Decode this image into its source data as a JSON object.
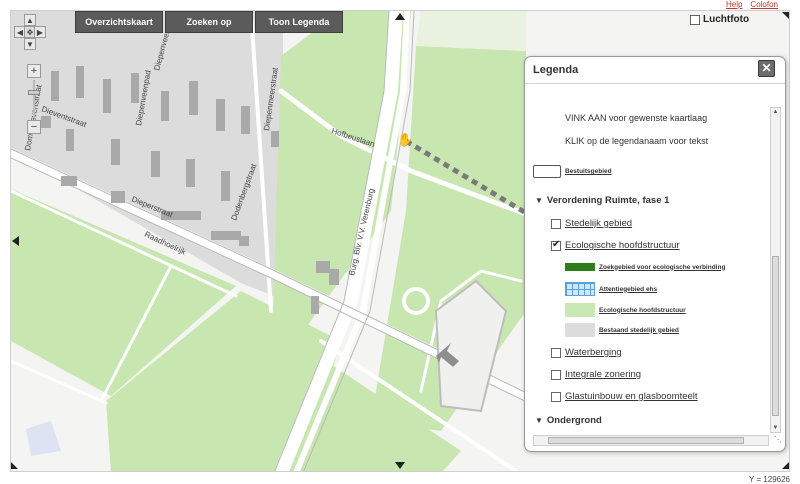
{
  "toolbar": {
    "overview_label": "Overzichtskaart",
    "search_label": "Zoeken op",
    "legend_label": "Toon Legenda"
  },
  "top_links": {
    "help_label": "Help",
    "colofon_label": "Colofon"
  },
  "aerial": {
    "label": "Luchtfoto",
    "checked": false
  },
  "map": {
    "streets": [
      {
        "name": "Dommelsvenstraat"
      },
      {
        "name": "Diepenveenpad"
      },
      {
        "name": "Dieventstraat"
      },
      {
        "name": "Diepenveenstraat"
      },
      {
        "name": "Dodenbergstraat"
      },
      {
        "name": "Dieperstraat"
      },
      {
        "name": "Diepenmeerstraat"
      },
      {
        "name": "Raadhoelrijk"
      },
      {
        "name": "Burg. Blv. V.V. Verenburg"
      },
      {
        "name": "Hofbeuslaan"
      }
    ],
    "colors": {
      "residential": "#dcdcdc",
      "green": "#c8e6b0",
      "road": "#ffffff",
      "building": "#a9a9a9",
      "background": "#f4f4f2"
    }
  },
  "legend": {
    "title": "Legenda",
    "close_icon": "close-icon",
    "instruction_1": "VINK AAN voor gewenste kaartlaag",
    "instruction_2": "KLIK op de legendanaam voor tekst",
    "base_label": "Bestuitsgebied",
    "group_1": {
      "label": "Verordening Ruimte, fase 1",
      "expanded": true,
      "layers": [
        {
          "label": "Stedelijk gebied",
          "checked": false
        },
        {
          "label": "Ecologische hoofdstructuur",
          "checked": true
        },
        {
          "label": "Waterberging",
          "checked": false
        },
        {
          "label": "Integrale zonering",
          "checked": false
        },
        {
          "label": "Glastuinbouw en glasboomteelt",
          "checked": false
        }
      ],
      "subitems": [
        {
          "label": "Zoekgebied voor ecologische verbinding",
          "color": "#2e7d1a"
        },
        {
          "label": "Attentiegebied ehs",
          "color": "#5aa0e0"
        },
        {
          "label": "Ecologische hoofdstructuur",
          "color": "#c8e8b4"
        },
        {
          "label": "Bestaand stedelijk gebied",
          "color": "#dcdcdc"
        }
      ]
    },
    "group_2": {
      "label": "Ondergrond",
      "expanded": true
    }
  },
  "coords": {
    "text": "Y = 129626"
  }
}
